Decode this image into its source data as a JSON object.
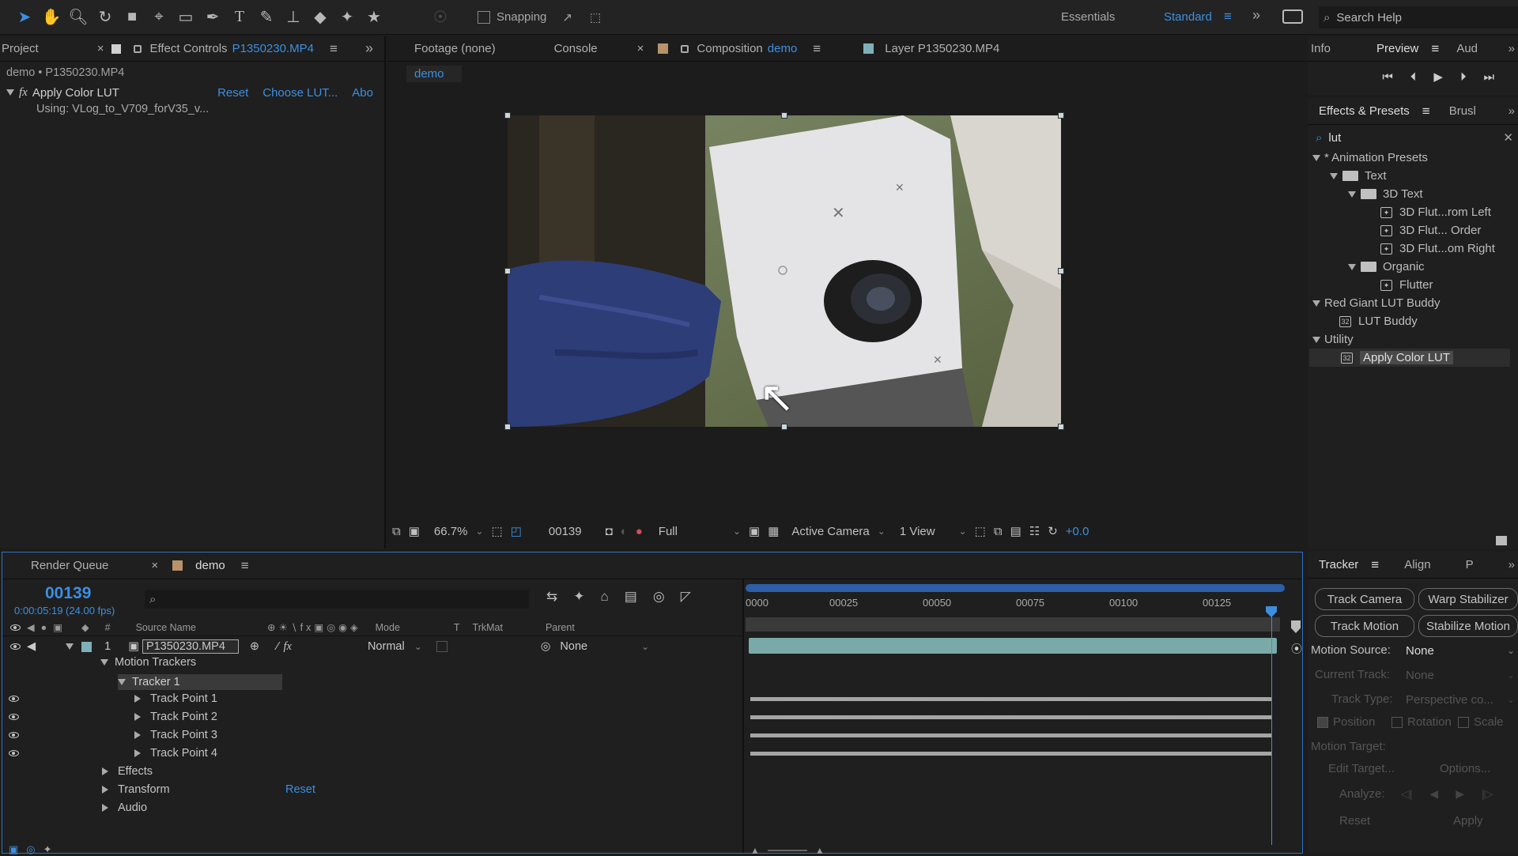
{
  "toolbar": {
    "snapping": "Snapping",
    "workspaces": [
      "Essentials",
      "Standard"
    ],
    "search_placeholder": "Search Help"
  },
  "left_panel": {
    "tab_project": "Project",
    "tab_effect_controls": "Effect Controls",
    "effect_controls_layer": "P1350230.MP4",
    "breadcrumb": "demo • P1350230.MP4",
    "effect_name": "Apply Color LUT",
    "reset": "Reset",
    "choose_lut": "Choose LUT...",
    "about": "Abo",
    "using": "Using: VLog_to_V709_forV35_v..."
  },
  "viewer": {
    "tabs": {
      "footage": "Footage (none)",
      "console": "Console",
      "composition_prefix": "Composition",
      "composition_name": "demo",
      "layer": "Layer P1350230.MP4"
    },
    "sub_tab": "demo",
    "zoom": "66.7%",
    "timecode": "00139",
    "resolution": "Full",
    "camera": "Active Camera",
    "views": "1 View",
    "exposure": "+0.0"
  },
  "right_top": {
    "tab_info": "Info",
    "tab_preview": "Preview",
    "tab_audio": "Aud"
  },
  "effects_presets": {
    "tab": "Effects & Presets",
    "tab_brush": "Brusl",
    "search": "lut",
    "tree": [
      {
        "label": "* Animation Presets",
        "level": 0,
        "kind": "section"
      },
      {
        "label": "Text",
        "level": 1,
        "kind": "folder"
      },
      {
        "label": "3D Text",
        "level": 2,
        "kind": "folder"
      },
      {
        "label": "3D Flut...rom Left",
        "level": 3,
        "kind": "preset"
      },
      {
        "label": "3D Flut... Order",
        "level": 3,
        "kind": "preset"
      },
      {
        "label": "3D Flut...om Right",
        "level": 3,
        "kind": "preset"
      },
      {
        "label": "Organic",
        "level": 2,
        "kind": "folder"
      },
      {
        "label": "Flutter",
        "level": 3,
        "kind": "preset"
      },
      {
        "label": "Red Giant LUT Buddy",
        "level": 0,
        "kind": "section"
      },
      {
        "label": "LUT Buddy",
        "level": 1,
        "kind": "effect"
      },
      {
        "label": "Utility",
        "level": 0,
        "kind": "section"
      },
      {
        "label": "Apply Color LUT",
        "level": 1,
        "kind": "effect",
        "selected": true
      }
    ]
  },
  "timeline": {
    "tab_render_queue": "Render Queue",
    "tab_comp": "demo",
    "timecode": "00139",
    "timecode_sub": "0:00:05:19 (24.00 fps)",
    "columns": {
      "num": "#",
      "source": "Source Name",
      "mode": "Mode",
      "t": "T",
      "trkmat": "TrkMat",
      "parent": "Parent"
    },
    "layer": {
      "index": "1",
      "name": "P1350230.MP4",
      "mode": "Normal",
      "parent": "None"
    },
    "rows": [
      "Motion Trackers",
      "Tracker 1",
      "Track Point 1",
      "Track Point 2",
      "Track Point 3",
      "Track Point 4",
      "Effects",
      "Transform",
      "Audio"
    ],
    "transform_reset": "Reset",
    "ruler": [
      "0000",
      "00025",
      "00050",
      "00075",
      "00100",
      "00125"
    ]
  },
  "tracker": {
    "tab": "Tracker",
    "tab_align": "Align",
    "tab_p": "P",
    "track_camera": "Track Camera",
    "warp_stabilizer": "Warp Stabilizer",
    "track_motion": "Track Motion",
    "stabilize_motion": "Stabilize Motion",
    "motion_source_label": "Motion Source:",
    "motion_source": "None",
    "current_track_label": "Current Track:",
    "current_track": "None",
    "track_type_label": "Track Type:",
    "track_type": "Perspective co...",
    "position": "Position",
    "rotation": "Rotation",
    "scale": "Scale",
    "motion_target_label": "Motion Target:",
    "edit_target": "Edit Target...",
    "options": "Options...",
    "analyze": "Analyze:",
    "reset": "Reset",
    "apply": "Apply"
  }
}
